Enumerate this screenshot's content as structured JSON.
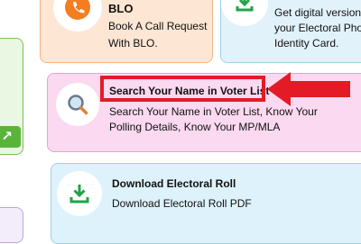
{
  "left_column": {
    "action_icon": "arrow-up-right-icon"
  },
  "blo_card": {
    "title": "BLO",
    "description_line1": "Book A Call Request",
    "description_line2": "With BLO.",
    "icon": "phone-icon"
  },
  "epic_card": {
    "description_line1": "Get digital version of",
    "description_line2": "your Electoral Photo",
    "description_line3": "Identity Card.",
    "icon": "download-icon"
  },
  "voter_search_card": {
    "title": "Search Your Name in Voter List",
    "description_line1": "Search Your Name in Voter List, Know Your",
    "description_line2": "Polling Details, Know Your MP/MLA",
    "icon": "magnifier-icon"
  },
  "electoral_roll_card": {
    "title": "Download Electoral Roll",
    "description": "Download Electoral Roll PDF",
    "icon": "download-icon"
  },
  "annotation": {
    "highlight_color": "#e21b26"
  },
  "colors": {
    "blo_bg": "#fde6d3",
    "epic_bg": "#e2f2fb",
    "voter_bg": "#fbd9f0",
    "roll_bg": "#def2fb",
    "left_green": "#5bb43a",
    "download_green": "#21a34a"
  }
}
